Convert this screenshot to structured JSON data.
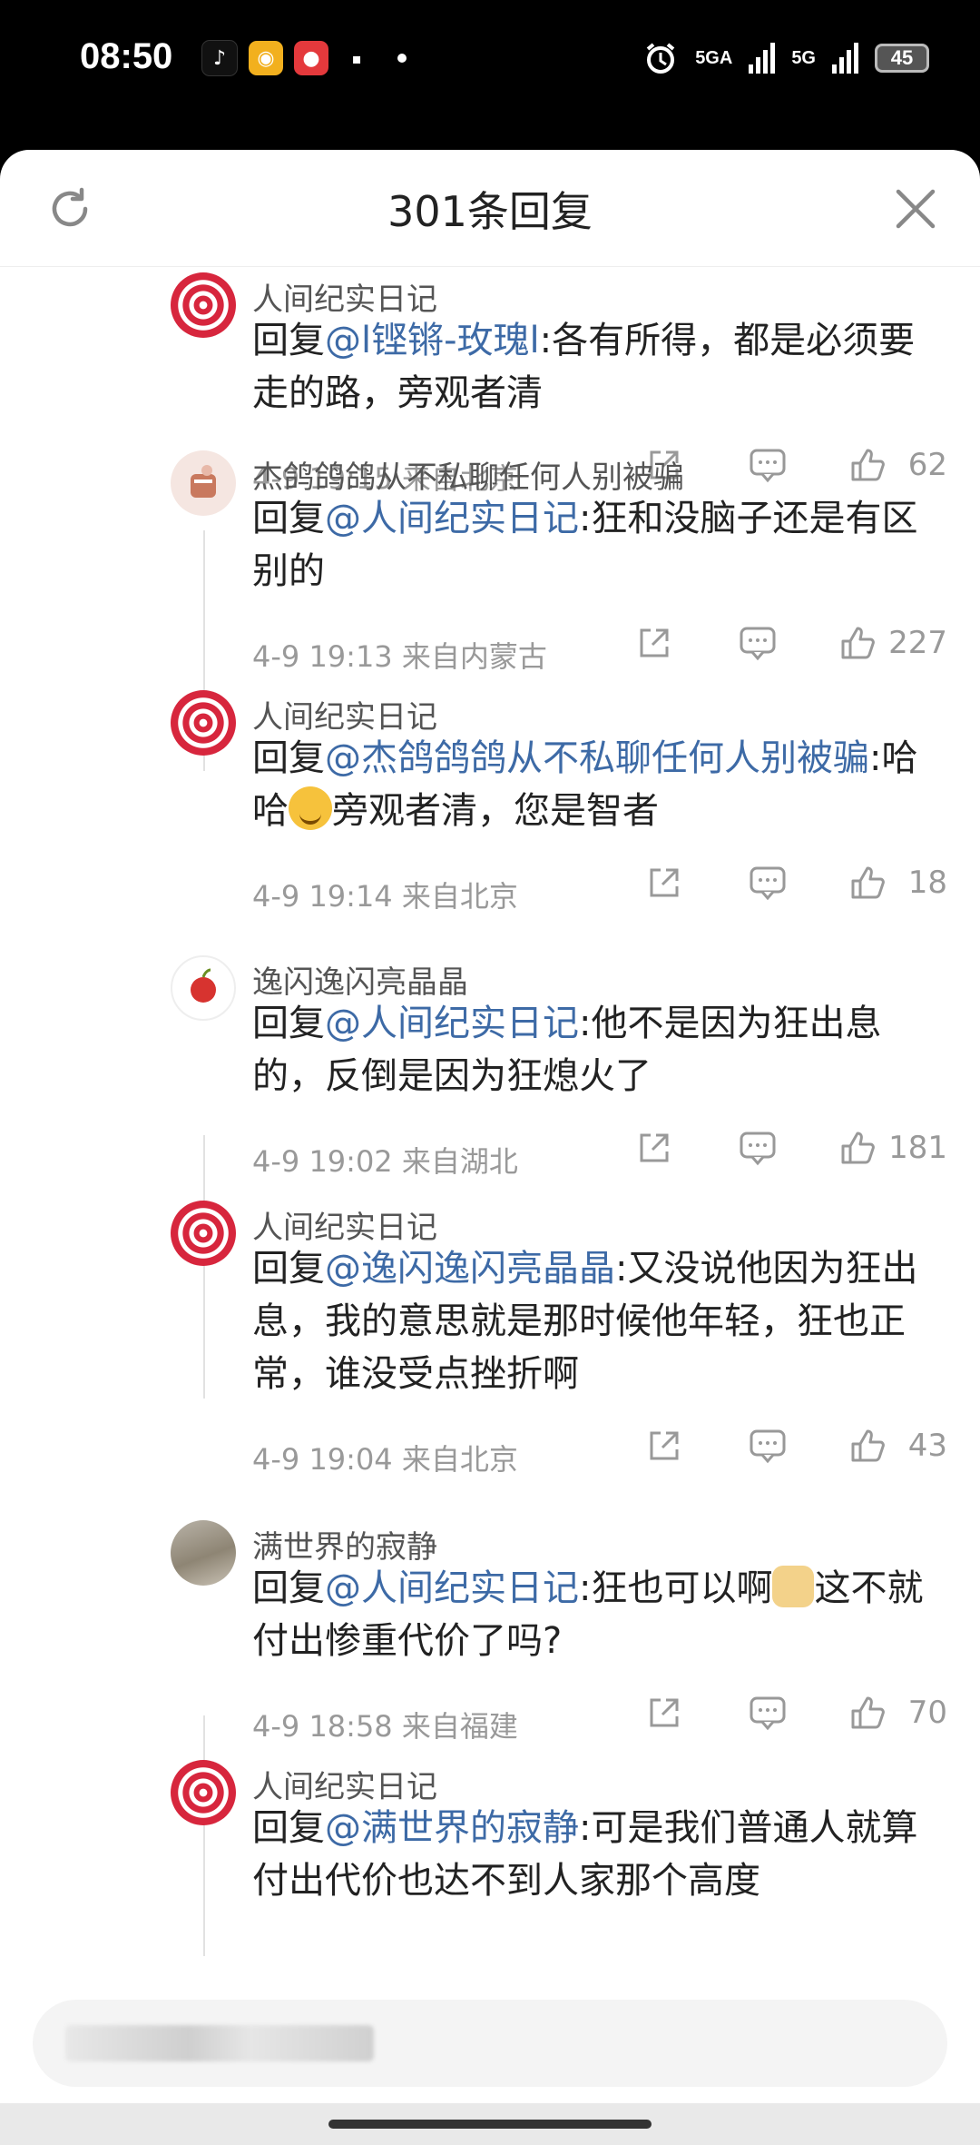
{
  "status_bar": {
    "time": "08:50",
    "network_1": "5GA",
    "network_2": "5G",
    "battery": "45"
  },
  "sheet": {
    "title": "301条回复"
  },
  "comments": [
    {
      "name": "人间纪实日记",
      "reply_prefix": "回复",
      "at": "@l铿锵-玫瑰l",
      "text": ":各有所得，都是必须要走的路，旁观者清",
      "time": "4-9 19:15",
      "location": "来自北京",
      "likes": "62"
    },
    {
      "name": "杰鸽鸽鸽从不私聊任何人别被骗",
      "reply_prefix": "回复",
      "at": "@人间纪实日记",
      "text": ":狂和没脑子还是有区别的",
      "time": "4-9 19:13",
      "location": "来自内蒙古",
      "likes": "227"
    },
    {
      "name": "人间纪实日记",
      "reply_prefix": "回复",
      "at": "@杰鸽鸽鸽从不私聊任何人别被骗",
      "text_before": ":哈哈",
      "text_after": "旁观者清，您是智者",
      "time": "4-9 19:14",
      "location": "来自北京",
      "likes": "18"
    },
    {
      "name": "逸闪逸闪亮晶晶",
      "reply_prefix": "回复",
      "at": "@人间纪实日记",
      "text": ":他不是因为狂出息的，反倒是因为狂熄火了",
      "time": "4-9 19:02",
      "location": "来自湖北",
      "likes": "181"
    },
    {
      "name": "人间纪实日记",
      "reply_prefix": "回复",
      "at": "@逸闪逸闪亮晶晶",
      "text": ":又没说他因为狂出息，我的意思就是那时候他年轻，狂也正常，谁没受点挫折啊",
      "time": "4-9 19:04",
      "location": "来自北京",
      "likes": "43"
    },
    {
      "name": "满世界的寂静",
      "reply_prefix": "回复",
      "at": "@人间纪实日记",
      "text_before": ":狂也可以啊",
      "text_after": "这不就付出惨重代价了吗?",
      "time": "4-9 18:58",
      "location": "来自福建",
      "likes": "70"
    },
    {
      "name": "人间纪实日记",
      "reply_prefix": "回复",
      "at": "@满世界的寂静",
      "text": ":可是我们普通人就算付出代价也达不到人家那个高度"
    }
  ],
  "icons": [
    "refresh-icon",
    "close-icon",
    "share-icon",
    "comment-icon",
    "like-icon"
  ]
}
